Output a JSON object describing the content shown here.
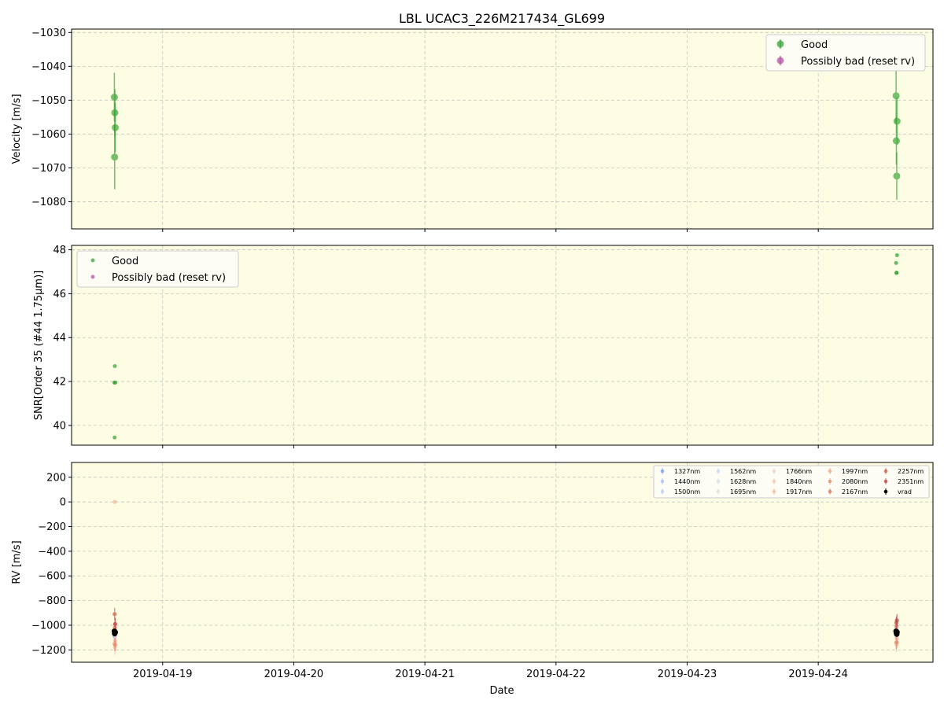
{
  "chart_data": [
    {
      "type": "scatter",
      "title": "LBL UCAC3_226M217434_GL699",
      "xlabel": "",
      "ylabel": "Velocity [m/s]",
      "ylim": [
        -1088,
        -1029
      ],
      "yticks": [
        -1030,
        -1040,
        -1050,
        -1060,
        -1070,
        -1080
      ],
      "ytick_labels": [
        "−1030",
        "−1040",
        "−1050",
        "−1060",
        "−1070",
        "−1080"
      ],
      "grid": true,
      "legend_position": "upper-right",
      "series": [
        {
          "name": "Good",
          "color": "#2ca02c",
          "marker": "circle-errorbar",
          "points": [
            {
              "x": "2019-04-18 15:10",
              "y": -1049.1,
              "err": 7.2
            },
            {
              "x": "2019-04-18 15:15",
              "y": -1053.7,
              "err": 7.0
            },
            {
              "x": "2019-04-18 15:13",
              "y": -1066.8,
              "err": 9.5
            },
            {
              "x": "2019-04-18 15:20",
              "y": -1058.1,
              "err": 7.3
            },
            {
              "x": "2019-04-24 14:15",
              "y": -1048.7,
              "err": 8.0
            },
            {
              "x": "2019-04-24 14:18",
              "y": -1062.0,
              "err": 7.0
            },
            {
              "x": "2019-04-24 14:25",
              "y": -1056.2,
              "err": 7.0
            },
            {
              "x": "2019-04-24 14:22",
              "y": -1072.4,
              "err": 7.0
            }
          ]
        },
        {
          "name": "Possibly bad (reset rv)",
          "color": "#b0489f",
          "marker": "circle-errorbar",
          "points": []
        }
      ]
    },
    {
      "type": "scatter",
      "title": "",
      "xlabel": "",
      "ylabel": "SNR[Order 35 (#44 1.75μm)]",
      "ylim": [
        39.1,
        48.2
      ],
      "yticks": [
        40,
        42,
        44,
        46,
        48
      ],
      "ytick_labels": [
        "40",
        "42",
        "44",
        "46",
        "48"
      ],
      "grid": true,
      "legend_position": "upper-left",
      "series": [
        {
          "name": "Good",
          "color": "#2ca02c",
          "marker": "dot",
          "points": [
            {
              "x": "2019-04-18 15:10",
              "y": 41.95
            },
            {
              "x": "2019-04-18 15:20",
              "y": 41.95
            },
            {
              "x": "2019-04-18 15:15",
              "y": 42.7
            },
            {
              "x": "2019-04-18 15:13",
              "y": 39.45
            },
            {
              "x": "2019-04-24 14:15",
              "y": 47.4
            },
            {
              "x": "2019-04-24 14:18",
              "y": 46.95
            },
            {
              "x": "2019-04-24 14:22",
              "y": 46.95
            },
            {
              "x": "2019-04-24 14:25",
              "y": 47.75
            }
          ]
        },
        {
          "name": "Possibly bad (reset rv)",
          "color": "#b0489f",
          "marker": "dot",
          "points": []
        }
      ]
    },
    {
      "type": "scatter",
      "title": "",
      "xlabel": "Date",
      "ylabel": "RV [m/s]",
      "ylim": [
        -1300,
        320
      ],
      "yticks": [
        200,
        0,
        -200,
        -400,
        -600,
        -800,
        -1000,
        -1200
      ],
      "ytick_labels": [
        "200",
        "0",
        "−200",
        "−400",
        "−600",
        "−800",
        "−1000",
        "−1200"
      ],
      "xlim": [
        "2019-04-18 07:20",
        "2019-04-24 21:00"
      ],
      "xticks": [
        "2019-04-19",
        "2019-04-20",
        "2019-04-21",
        "2019-04-22",
        "2019-04-23",
        "2019-04-24"
      ],
      "xtick_labels": [
        "2019-04-19",
        "2019-04-20",
        "2019-04-21",
        "2019-04-22",
        "2019-04-23",
        "2019-04-24"
      ],
      "grid": true,
      "legend_position": "upper-right",
      "legend_columns": 5,
      "series": [
        {
          "name": "1327nm",
          "color": "#6f96f3",
          "points": [
            {
              "x": "2019-04-18 15:14",
              "y": -1090,
              "err": 60
            },
            {
              "x": "2019-04-24 14:18",
              "y": -1080,
              "err": 60
            }
          ]
        },
        {
          "name": "1440nm",
          "color": "#9ebdf9",
          "points": [
            {
              "x": "2019-04-18 15:16",
              "y": -1040,
              "err": 50
            },
            {
              "x": "2019-04-24 14:20",
              "y": -1030,
              "err": 50
            }
          ]
        },
        {
          "name": "1500nm",
          "color": "#b3cbf8",
          "points": [
            {
              "x": "2019-04-18 15:12",
              "y": -1060,
              "err": 50
            },
            {
              "x": "2019-04-24 14:16",
              "y": -1050,
              "err": 50
            }
          ]
        },
        {
          "name": "1562nm",
          "color": "#c6d6f1",
          "points": [
            {
              "x": "2019-04-18 15:18",
              "y": -1070,
              "err": 50
            },
            {
              "x": "2019-04-24 14:22",
              "y": -1060,
              "err": 50
            }
          ]
        },
        {
          "name": "1628nm",
          "color": "#d5dbe8",
          "points": [
            {
              "x": "2019-04-18 15:15",
              "y": -1110,
              "err": 50
            },
            {
              "x": "2019-04-24 14:19",
              "y": -1100,
              "err": 50
            }
          ]
        },
        {
          "name": "1695nm",
          "color": "#e0dcdc",
          "points": [
            {
              "x": "2019-04-18 15:17",
              "y": -1050,
              "err": 50
            },
            {
              "x": "2019-04-24 14:21",
              "y": -1040,
              "err": 50
            }
          ]
        },
        {
          "name": "1766nm",
          "color": "#ecd2c8",
          "points": [
            {
              "x": "2019-04-18 15:13",
              "y": -1000,
              "err": 60
            },
            {
              "x": "2019-04-24 14:17",
              "y": -990,
              "err": 60
            }
          ]
        },
        {
          "name": "1840nm",
          "color": "#f3c3af",
          "points": [
            {
              "x": "2019-04-18 15:16",
              "y": -1180,
              "err": 60
            },
            {
              "x": "2019-04-24 14:20",
              "y": -1160,
              "err": 60
            }
          ]
        },
        {
          "name": "1917nm",
          "color": "#f6b396",
          "points": [
            {
              "x": "2019-04-18 15:14",
              "y": 0,
              "err": 8
            },
            {
              "x": "2019-04-18 15:19",
              "y": -1130,
              "err": 60
            },
            {
              "x": "2019-04-24 14:23",
              "y": -1110,
              "err": 60
            }
          ]
        },
        {
          "name": "1997nm",
          "color": "#f29f7e",
          "points": [
            {
              "x": "2019-04-18 15:12",
              "y": -1150,
              "err": 60
            },
            {
              "x": "2019-04-24 14:16",
              "y": -1140,
              "err": 60
            }
          ]
        },
        {
          "name": "2080nm",
          "color": "#ea8465",
          "points": [
            {
              "x": "2019-04-18 15:18",
              "y": -1160,
              "err": 50
            },
            {
              "x": "2019-04-24 14:22",
              "y": -1140,
              "err": 50
            }
          ]
        },
        {
          "name": "2167nm",
          "color": "#de6a4f",
          "points": [
            {
              "x": "2019-04-18 15:15",
              "y": -1020,
              "err": 50
            },
            {
              "x": "2019-04-24 14:19",
              "y": -1010,
              "err": 50
            }
          ]
        },
        {
          "name": "2257nm",
          "color": "#cd4f3f",
          "points": [
            {
              "x": "2019-04-18 15:13",
              "y": -910,
              "err": 50
            },
            {
              "x": "2019-04-24 14:17",
              "y": -980,
              "err": 50
            }
          ]
        },
        {
          "name": "2351nm",
          "color": "#b73432",
          "points": [
            {
              "x": "2019-04-18 15:19",
              "y": -990,
              "err": 50
            },
            {
              "x": "2019-04-24 14:24",
              "y": -960,
              "err": 50
            }
          ]
        },
        {
          "name": "vrad",
          "color": "#000000",
          "points": [
            {
              "x": "2019-04-18 15:10",
              "y": -1049,
              "err": 7
            },
            {
              "x": "2019-04-18 15:15",
              "y": -1054,
              "err": 7
            },
            {
              "x": "2019-04-18 15:13",
              "y": -1067,
              "err": 10
            },
            {
              "x": "2019-04-18 15:20",
              "y": -1058,
              "err": 7
            },
            {
              "x": "2019-04-24 14:15",
              "y": -1049,
              "err": 8
            },
            {
              "x": "2019-04-24 14:18",
              "y": -1062,
              "err": 7
            },
            {
              "x": "2019-04-24 14:25",
              "y": -1056,
              "err": 7
            },
            {
              "x": "2019-04-24 14:22",
              "y": -1072,
              "err": 7
            }
          ]
        }
      ]
    }
  ]
}
